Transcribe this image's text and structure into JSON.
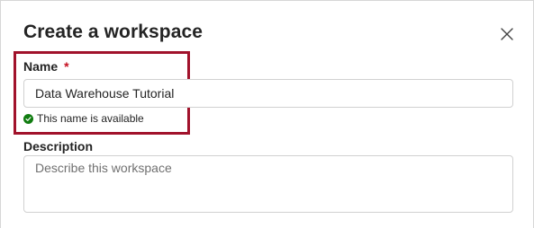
{
  "dialog": {
    "title": "Create a workspace"
  },
  "name_field": {
    "label": "Name",
    "required_marker": "*",
    "value": "Data Warehouse Tutorial",
    "status_text": "This name is available"
  },
  "description_field": {
    "label": "Description",
    "placeholder": "Describe this workspace",
    "value": ""
  },
  "colors": {
    "highlight_border": "#a1122b",
    "required_star": "#c50f1f",
    "success_icon": "#107c10"
  },
  "icons": {
    "close": "close-icon",
    "status": "checkmark-circle-icon"
  }
}
